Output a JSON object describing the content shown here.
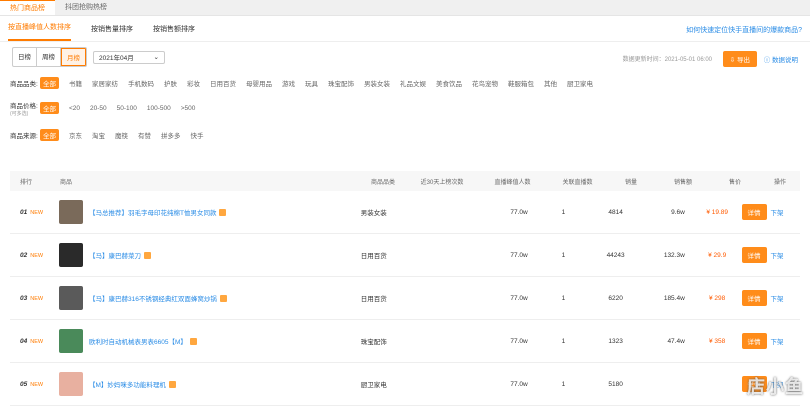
{
  "top_tabs": [
    "热门商品榜",
    "抖团抢购热榜"
  ],
  "sub_tabs": [
    "按直播峰值人数排序",
    "按销售量排序",
    "按销售额排序"
  ],
  "help_link": "如何快速定位快手直播间的爆款商品?",
  "period": {
    "options": [
      "日榜",
      "周榜",
      "月榜"
    ],
    "selected": "月榜"
  },
  "month_select": {
    "value": "2021年04月"
  },
  "update_time": "数据更新时间：2021-05-01 06:00",
  "export_label": "导出",
  "explain_label": "数据说明",
  "filters": {
    "category": {
      "label": "商品品类:",
      "options": [
        "全部",
        "书籍",
        "家居家纺",
        "手机数码",
        "护肤",
        "彩妆",
        "日用百货",
        "母婴用品",
        "游戏",
        "玩具",
        "珠宝配饰",
        "男装女装",
        "礼品文娱",
        "美食饮品",
        "花鸟宠物",
        "鞋服箱包",
        "其他",
        "厨卫家电"
      ]
    },
    "price": {
      "label": "商品价格:",
      "sublabel": "(可多选)",
      "options": [
        "全部",
        "<20",
        "20-50",
        "50-100",
        "100-500",
        ">500"
      ]
    },
    "source": {
      "label": "商品来源:",
      "options": [
        "全部",
        "京东",
        "淘宝",
        "魔筷",
        "有赞",
        "拼多多",
        "快手"
      ]
    }
  },
  "table": {
    "headers": [
      "排行",
      "商品",
      "商品品类",
      "近30天上榜次数",
      "直播峰值人数",
      "关联直播数",
      "销量",
      "销售额",
      "售价",
      "操作"
    ],
    "rows": [
      {
        "rank": "01",
        "badge": "NEW",
        "title": "【马总推荐】羽毛字母印花纯棉T恤男女同款",
        "category": "男装女装",
        "count": "",
        "hot": "77.0w",
        "live": "1",
        "sales": "4814",
        "amount": "9.6w",
        "price": "¥ 19.89",
        "thumb_color": "#7a6a5a"
      },
      {
        "rank": "02",
        "badge": "NEW",
        "title": "【马】康巴赫菜刀",
        "category": "日用百货",
        "count": "",
        "hot": "77.0w",
        "live": "1",
        "sales": "44243",
        "amount": "132.3w",
        "price": "¥ 29.9",
        "thumb_color": "#2a2a2a"
      },
      {
        "rank": "03",
        "badge": "NEW",
        "title": "【马】康巴赫316不锈钢经典红双面蜂窝炒锅",
        "category": "日用百货",
        "count": "",
        "hot": "77.0w",
        "live": "1",
        "sales": "6220",
        "amount": "185.4w",
        "price": "¥ 298",
        "thumb_color": "#5a5a5a"
      },
      {
        "rank": "04",
        "badge": "NEW",
        "title": "欧利时自动机械表男表6605【M】",
        "category": "珠宝配饰",
        "count": "",
        "hot": "77.0w",
        "live": "1",
        "sales": "1323",
        "amount": "47.4w",
        "price": "¥ 358",
        "thumb_color": "#4a8a5a"
      },
      {
        "rank": "05",
        "badge": "NEW",
        "title": "【M】妙妈咪多功能料理机",
        "category": "厨卫家电",
        "count": "",
        "hot": "77.0w",
        "live": "1",
        "sales": "5180",
        "amount": "",
        "price": "",
        "thumb_color": "#e8b0a0"
      }
    ],
    "detail_label": "详情",
    "down_label": "下架"
  },
  "watermark": "店小鱼"
}
